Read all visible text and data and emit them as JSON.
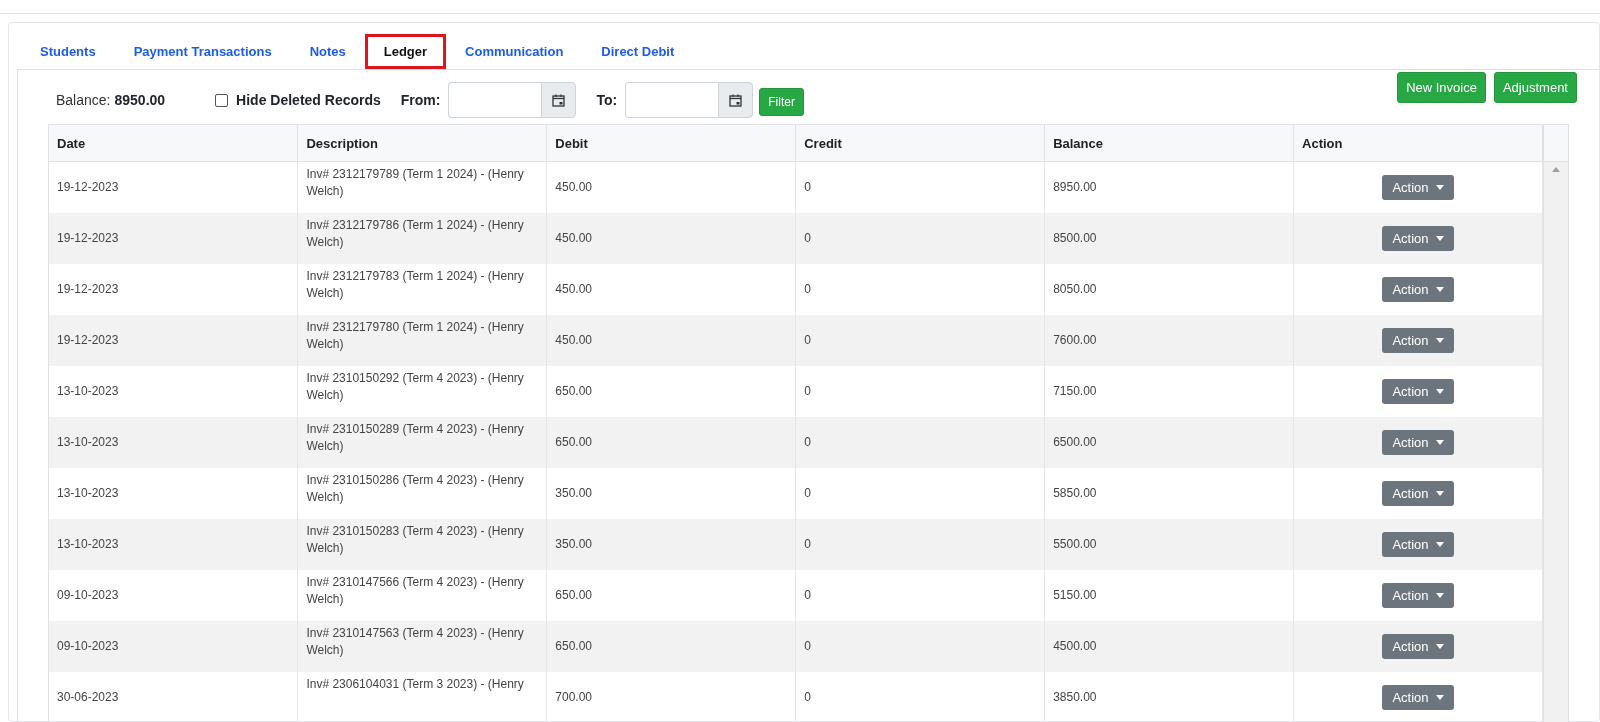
{
  "tabs": [
    {
      "label": "Students",
      "selected": false
    },
    {
      "label": "Payment Transactions",
      "selected": false
    },
    {
      "label": "Notes",
      "selected": false
    },
    {
      "label": "Ledger",
      "selected": true
    },
    {
      "label": "Communication",
      "selected": false
    },
    {
      "label": "Direct Debit",
      "selected": false
    }
  ],
  "toolbar": {
    "balance_label": "Balance:",
    "balance_value": "8950.00",
    "hide_deleted": {
      "label": "Hide Deleted Records",
      "checked": false
    },
    "from_label": "From:",
    "to_label": "To:",
    "filter_button": "Filter",
    "buttons": [
      "New Invoice",
      "Adjustment"
    ]
  },
  "table": {
    "columns": [
      "Date",
      "Description",
      "Debit",
      "Credit",
      "Balance",
      "Action"
    ],
    "rows": [
      {
        "date": "19-12-2023",
        "description": "Inv# 2312179789 (Term 1 2024) - (Henry Welch)",
        "debit": "450.00",
        "credit": "0",
        "balance": "8950.00",
        "action": "Action"
      },
      {
        "date": "19-12-2023",
        "description": "Inv# 2312179786 (Term 1 2024) - (Henry Welch)",
        "debit": "450.00",
        "credit": "0",
        "balance": "8500.00",
        "action": "Action"
      },
      {
        "date": "19-12-2023",
        "description": "Inv# 2312179783 (Term 1 2024) - (Henry Welch)",
        "debit": "450.00",
        "credit": "0",
        "balance": "8050.00",
        "action": "Action"
      },
      {
        "date": "19-12-2023",
        "description": "Inv# 2312179780 (Term 1 2024) - (Henry Welch)",
        "debit": "450.00",
        "credit": "0",
        "balance": "7600.00",
        "action": "Action"
      },
      {
        "date": "13-10-2023",
        "description": "Inv# 2310150292 (Term 4 2023) - (Henry Welch)",
        "debit": "650.00",
        "credit": "0",
        "balance": "7150.00",
        "action": "Action"
      },
      {
        "date": "13-10-2023",
        "description": "Inv# 2310150289 (Term 4 2023) - (Henry Welch)",
        "debit": "650.00",
        "credit": "0",
        "balance": "6500.00",
        "action": "Action"
      },
      {
        "date": "13-10-2023",
        "description": "Inv# 2310150286 (Term 4 2023) - (Henry Welch)",
        "debit": "350.00",
        "credit": "0",
        "balance": "5850.00",
        "action": "Action"
      },
      {
        "date": "13-10-2023",
        "description": "Inv# 2310150283 (Term 4 2023) - (Henry Welch)",
        "debit": "350.00",
        "credit": "0",
        "balance": "5500.00",
        "action": "Action"
      },
      {
        "date": "09-10-2023",
        "description": "Inv# 2310147566 (Term 4 2023) - (Henry Welch)",
        "debit": "650.00",
        "credit": "0",
        "balance": "5150.00",
        "action": "Action"
      },
      {
        "date": "09-10-2023",
        "description": "Inv# 2310147563 (Term 4 2023) - (Henry Welch)",
        "debit": "650.00",
        "credit": "0",
        "balance": "4500.00",
        "action": "Action"
      },
      {
        "date": "30-06-2023",
        "description": "Inv# 2306104031 (Term 3 2023) - (Henry",
        "debit": "700.00",
        "credit": "0",
        "balance": "3850.00",
        "action": "Action"
      }
    ]
  }
}
